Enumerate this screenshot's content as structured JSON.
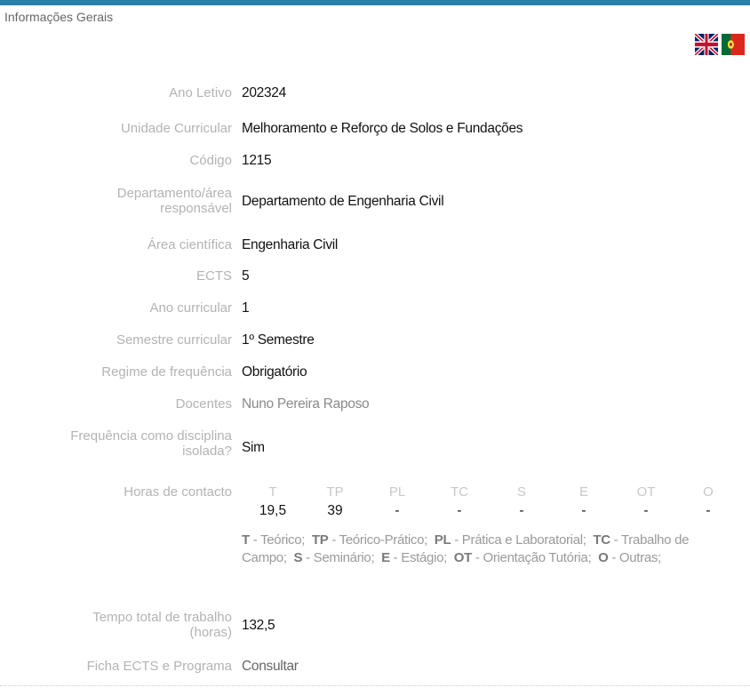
{
  "header": {
    "title": "Informações Gerais"
  },
  "flags": {
    "english": "English",
    "portuguese": "Português"
  },
  "fields": {
    "ano_letivo": {
      "label": "Ano Letivo",
      "value": "202324"
    },
    "unidade": {
      "label": "Unidade Curricular",
      "value": "Melhoramento e Reforço de Solos e Fundações"
    },
    "codigo": {
      "label": "Código",
      "value": "1215"
    },
    "departamento": {
      "label1": "Departamento/área",
      "label2": "responsável",
      "value": "Departamento de Engenharia Civil"
    },
    "area": {
      "label": "Área científica",
      "value": "Engenharia Civil"
    },
    "ects": {
      "label": "ECTS",
      "value": "5"
    },
    "ano_curricular": {
      "label": "Ano curricular",
      "value": "1"
    },
    "semestre": {
      "label": "Semestre curricular",
      "value": "1º Semestre"
    },
    "regime": {
      "label": "Regime de frequência",
      "value": "Obrigatório"
    },
    "docentes": {
      "label": "Docentes",
      "value": "Nuno Pereira Raposo"
    },
    "isolada": {
      "label1": "Frequência como disciplina",
      "label2": "isolada?",
      "value": "Sim"
    },
    "horas": {
      "label": "Horas de contacto"
    },
    "tempo": {
      "label1": "Tempo total de trabalho",
      "label2": "(horas)",
      "value": "132,5"
    },
    "ficha": {
      "label": "Ficha ECTS e Programa",
      "value": "Consultar"
    }
  },
  "hours": {
    "headers": [
      "T",
      "TP",
      "PL",
      "TC",
      "S",
      "E",
      "OT",
      "O"
    ],
    "values": [
      "19,5",
      "39",
      "-",
      "-",
      "-",
      "-",
      "-",
      "-"
    ]
  },
  "legend": [
    {
      "abbr": "T",
      "text": " - Teórico;"
    },
    {
      "abbr": "TP",
      "text": " - Teórico-Prático;"
    },
    {
      "abbr": "PL",
      "text": " - Prática e Laboratorial;"
    },
    {
      "abbr": "TC",
      "text": " - Trabalho de Campo;"
    },
    {
      "abbr": "S",
      "text": " - Seminário;"
    },
    {
      "abbr": "E",
      "text": " - Estágio;"
    },
    {
      "abbr": "OT",
      "text": " - Orientação Tutória;"
    },
    {
      "abbr": "O",
      "text": " - Outras;"
    }
  ],
  "colors": {
    "accent": "#2a7fa8",
    "label": "#b3b3b3"
  }
}
